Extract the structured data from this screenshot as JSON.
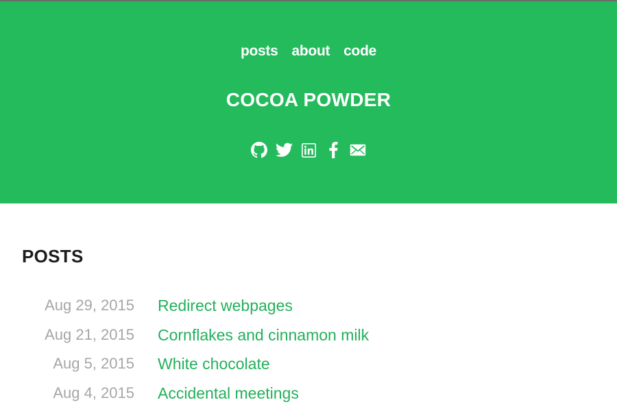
{
  "nav": {
    "items": [
      {
        "label": "posts"
      },
      {
        "label": "about"
      },
      {
        "label": "code"
      }
    ]
  },
  "site": {
    "title": "COCOA POWDER",
    "accent_color": "#23bb5c",
    "link_color": "#23b05a"
  },
  "social": {
    "icons": [
      "github-icon",
      "twitter-icon",
      "linkedin-icon",
      "facebook-icon",
      "email-icon"
    ]
  },
  "posts": {
    "heading": "POSTS",
    "items": [
      {
        "date": "Aug 29, 2015",
        "title": "Redirect webpages"
      },
      {
        "date": "Aug 21, 2015",
        "title": "Cornflakes and cinnamon milk"
      },
      {
        "date": "Aug 5, 2015",
        "title": "White chocolate"
      },
      {
        "date": "Aug 4, 2015",
        "title": "Accidental meetings"
      }
    ]
  }
}
